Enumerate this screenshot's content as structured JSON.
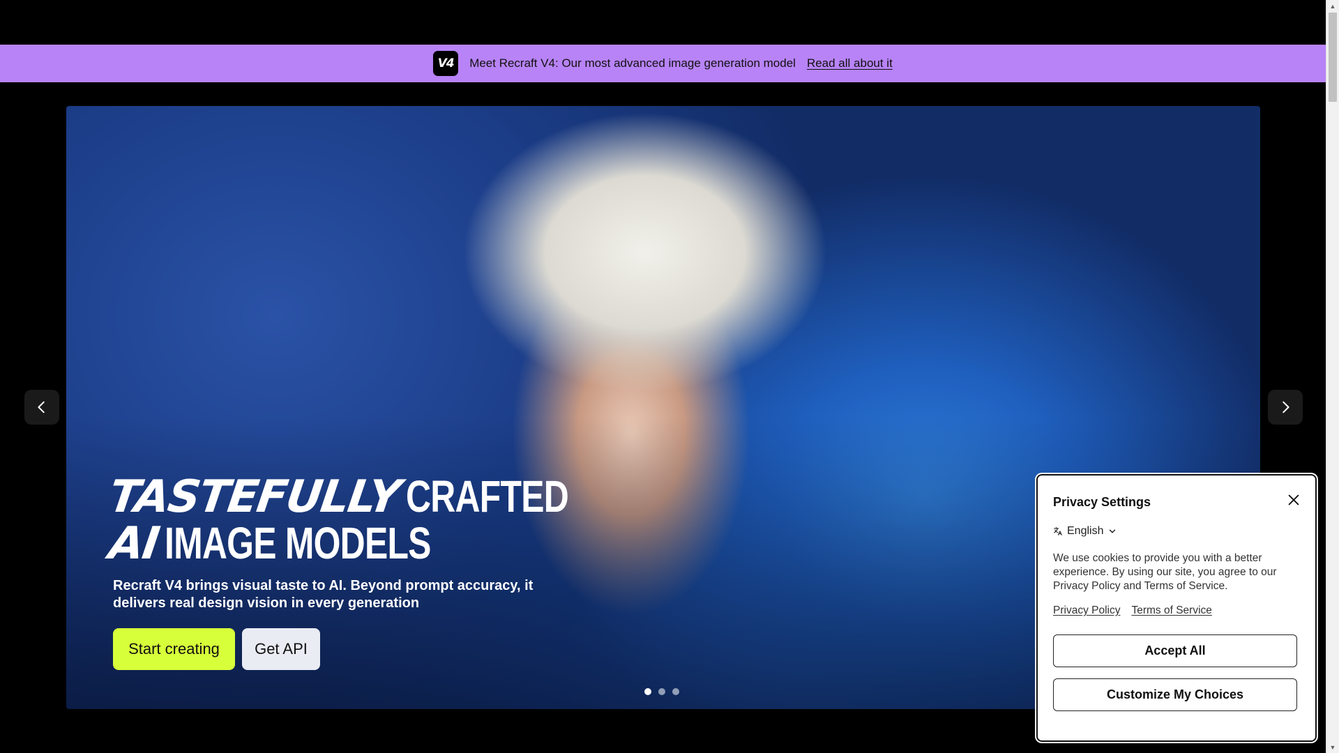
{
  "banner": {
    "badge": "V4",
    "message": "Meet Recraft V4: Our most advanced image generation model",
    "link": "Read all about it"
  },
  "hero": {
    "headline": {
      "line1_italic": "TASTEFULLY",
      "line1_rest": "CRAFTED",
      "line2_italic": "AI",
      "line2_rest": "IMAGE MODELS"
    },
    "subtitle": "Recraft V4 brings visual taste to AI. Beyond prompt accuracy, it delivers real design vision in every generation",
    "primary_cta": "Start creating",
    "secondary_cta": "Get API",
    "slides": {
      "count": 3,
      "active_index": 0
    }
  },
  "privacy": {
    "title": "Privacy Settings",
    "language": "English",
    "body": "We use cookies to provide you with a better experience. By using our site, you agree to our Privacy Policy and Terms of Service.",
    "links": [
      "Privacy Policy",
      "Terms of Service"
    ],
    "accept_label": "Accept All",
    "customize_label": "Customize My Choices"
  },
  "colors": {
    "banner_bg": "#b883f7",
    "primary_cta_bg": "#d7ff3a",
    "secondary_cta_bg": "#e9ecf3",
    "page_bg": "#000000"
  },
  "icons": {
    "carousel_prev": "chevron-left-icon",
    "carousel_next": "chevron-right-icon",
    "modal_close": "close-icon",
    "language": "translate-icon",
    "language_dropdown": "chevron-down-icon"
  }
}
